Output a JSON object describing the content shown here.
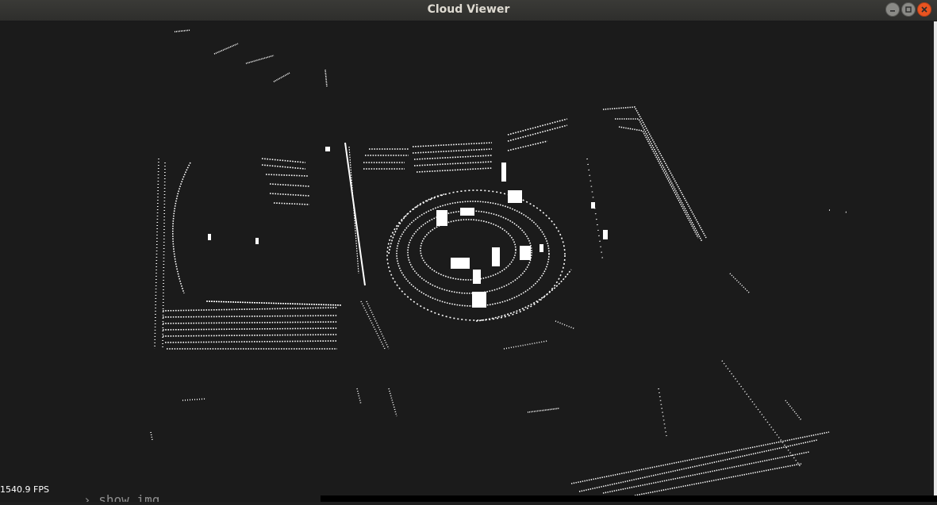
{
  "window": {
    "title": "Cloud Viewer",
    "buttons": {
      "minimize": "minimize-icon",
      "maximize": "maximize-icon",
      "close": "close-icon"
    },
    "colors": {
      "background": "#1b1b1b",
      "points": "#ffffff",
      "close_button": "#e95420"
    }
  },
  "status": {
    "fps": "1540.9 FPS"
  },
  "background_terminal": {
    "text": "›  show_img"
  }
}
